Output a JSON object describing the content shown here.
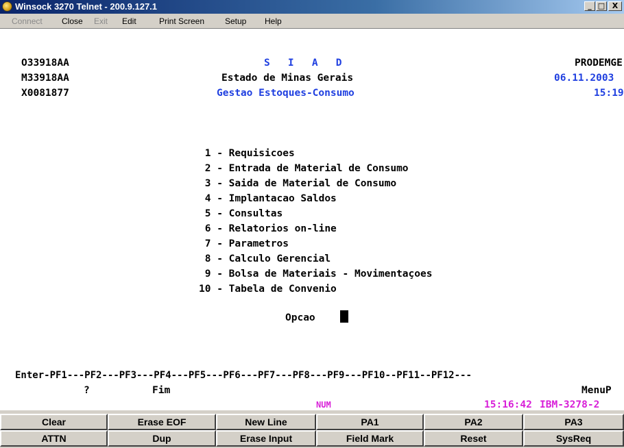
{
  "window": {
    "title": "Winsock 3270 Telnet - 200.9.127.1",
    "buttons": {
      "minimize": "_",
      "maximize": "□",
      "close": "X"
    }
  },
  "menu": [
    "Connect",
    "Close",
    "Exit",
    "Edit",
    "Print Screen",
    "Setup",
    "Help"
  ],
  "screen": {
    "left_ids": [
      "O33918AA",
      "M33918AA",
      "X0081877"
    ],
    "system": "S   I   A   D",
    "state": "Estado de Minas Gerais",
    "subtitle": "Gestao Estoques-Consumo",
    "org": "PRODEMGE",
    "date": "06.11.2003",
    "time": "15:19",
    "options": [
      " 1 - Requisicoes",
      " 2 - Entrada de Material de Consumo",
      " 3 - Saida de Material de Consumo",
      " 4 - Implantacao Saldos",
      " 5 - Consultas",
      " 6 - Relatorios on-line",
      " 7 - Parametros",
      " 8 - Calculo Gerencial",
      " 9 - Bolsa de Materiais - Movimentaçoes",
      "10 - Tabela de Convenio"
    ],
    "prompt": "Opcao",
    "pf_line": "Enter-PF1---PF2---PF3---PF4---PF5---PF6---PF7---PF8---PF9---PF10--PF11--PF12---",
    "pf1_label": "?",
    "pf3_label": "Fim",
    "screen_id": "MenuP",
    "status_num": "NUM",
    "status_time": "15:16:42",
    "status_model": "IBM-3278-2"
  },
  "keypad": {
    "row1": [
      "Clear",
      "Erase EOF",
      "New Line",
      "PA1",
      "PA2",
      "PA3"
    ],
    "row2": [
      "ATTN",
      "Dup",
      "Erase Input",
      "Field Mark",
      "Reset",
      "SysReq"
    ]
  }
}
